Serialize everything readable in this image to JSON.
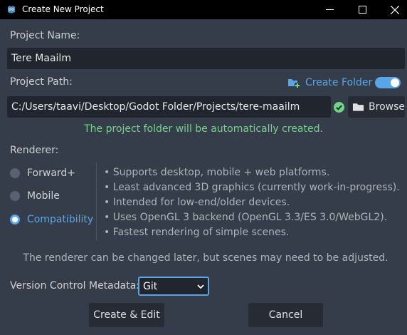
{
  "window": {
    "title": "Create New Project"
  },
  "project_name": {
    "label": "Project Name:",
    "value": "Tere Maailm"
  },
  "project_path": {
    "label": "Project Path:",
    "value": "C:/Users/taavi/Desktop/Godot Folder/Projects/tere-maailm",
    "create_folder_label": "Create Folder",
    "create_folder_enabled": true,
    "browse_label": "Browse",
    "status_message": "The project folder will be automatically created."
  },
  "renderer": {
    "label": "Renderer:",
    "options": [
      {
        "label": "Forward+",
        "selected": false
      },
      {
        "label": "Mobile",
        "selected": false
      },
      {
        "label": "Compatibility",
        "selected": true
      }
    ],
    "features": [
      "• Supports desktop, mobile + web platforms.",
      "• Least advanced 3D graphics (currently work-in-progress).",
      "• Intended for low-end/older devices.",
      "• Uses OpenGL 3 backend (OpenGL 3.3/ES 3.0/WebGL2).",
      "• Fastest rendering of simple scenes."
    ],
    "note": "The renderer can be changed later, but scenes may need to be adjusted."
  },
  "vcs": {
    "label": "Version Control Metadata:",
    "selected": "Git"
  },
  "actions": {
    "create_label": "Create & Edit",
    "cancel_label": "Cancel"
  },
  "colors": {
    "accent": "#58a6e8",
    "success": "#72d487",
    "background": "#363d4a",
    "field": "#21262e"
  }
}
